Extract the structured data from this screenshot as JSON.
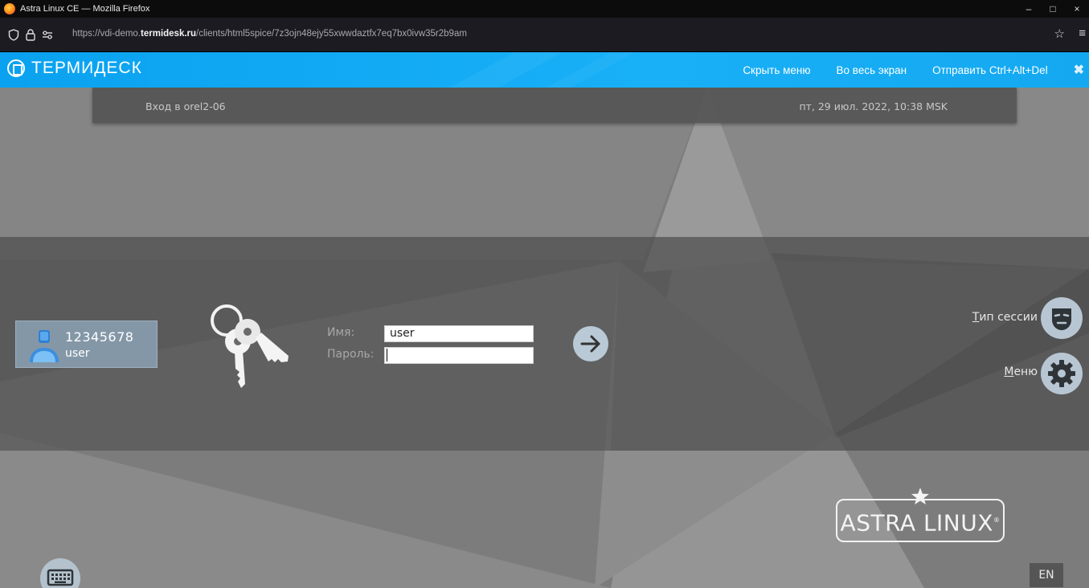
{
  "window": {
    "title": "Astra Linux CE — Mozilla Firefox",
    "controls": [
      "–",
      "□",
      "×"
    ]
  },
  "address_bar": {
    "url_prefix": "https://vdi-demo.",
    "url_domain": "termidesk.ru",
    "url_path": "/clients/html5spice/7z3ojn48ejy55xwwdaztfx7eq7bx0ivw35r2b9am"
  },
  "termidesk": {
    "logo_text": "ТЕРМИДЕСК",
    "menu": {
      "hide_menu": "Скрыть меню",
      "fullscreen": "Во весь экран",
      "send_cad": "Отправить Ctrl+Alt+Del",
      "close": "✖"
    }
  },
  "login": {
    "host_title": "Вход в orel2-06",
    "datetime": "пт, 29 июл. 2022, 10:38 MSK",
    "user_id": "12345678",
    "user_name": "user",
    "name_label": "Имя:",
    "name_value": "user",
    "password_label": "Пароль:",
    "password_value": "",
    "session_type_first": "Т",
    "session_type_rest": "ип сессии",
    "menu_first": "М",
    "menu_rest": "еню",
    "brand": "ASTRA LINUX",
    "brand_mark": "®",
    "lang": "EN"
  }
}
